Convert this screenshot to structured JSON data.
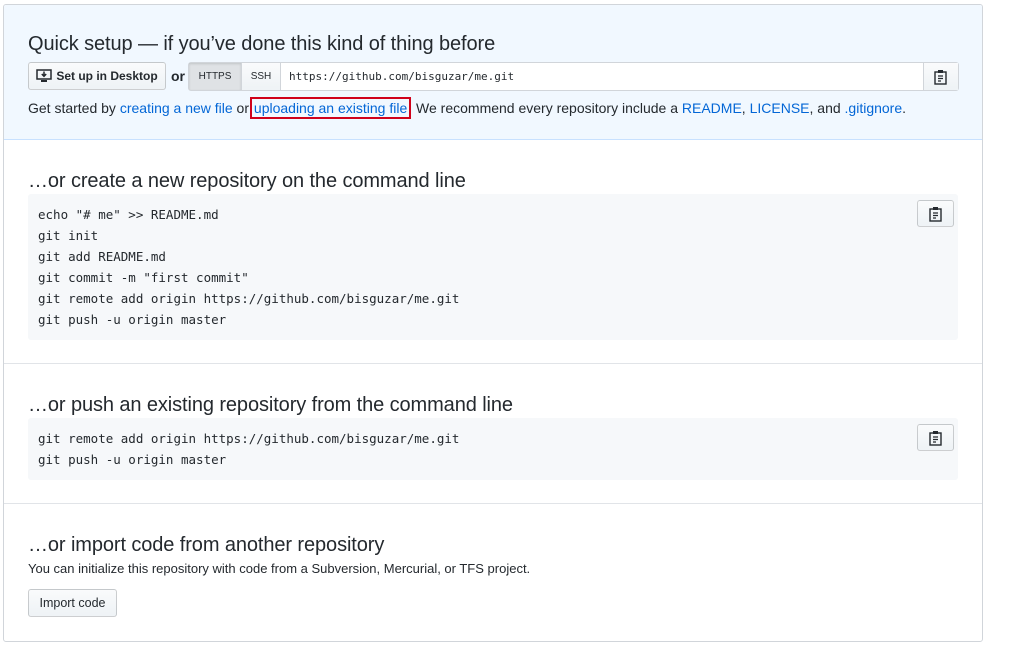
{
  "quick_setup": {
    "title": "Quick setup — if you’ve done this kind of thing before",
    "desktop_button": "Set up in Desktop",
    "or_label": "or",
    "protocols": [
      "HTTPS",
      "SSH"
    ],
    "selected_protocol": "HTTPS",
    "clone_url": "https://github.com/bisguzar/me.git",
    "getstarted": {
      "prefix": "Get started by ",
      "link_new_file": "creating a new file",
      "middle": " or ",
      "link_upload": "uploading an existing file",
      "after_upload": ". We recommend every repository include a ",
      "link_readme": "README",
      "comma1": ", ",
      "link_license": "LICENSE",
      "comma2": ", and ",
      "link_gitignore": ".gitignore",
      "suffix": "."
    }
  },
  "new_repo": {
    "title": "…or create a new repository on the command line",
    "lines": [
      "echo \"# me\" >> README.md",
      "git init",
      "git add README.md",
      "git commit -m \"first commit\"",
      "git remote add origin https://github.com/bisguzar/me.git",
      "git push -u origin master"
    ]
  },
  "push_existing": {
    "title": "…or push an existing repository from the command line",
    "lines": [
      "git remote add origin https://github.com/bisguzar/me.git",
      "git push -u origin master"
    ]
  },
  "import": {
    "title": "…or import code from another repository",
    "description": "You can initialize this repository with code from a Subversion, Mercurial, or TFS project.",
    "button": "Import code"
  },
  "icons": {
    "desktop": "desktop-download-icon",
    "clipboard": "clippy-icon"
  }
}
